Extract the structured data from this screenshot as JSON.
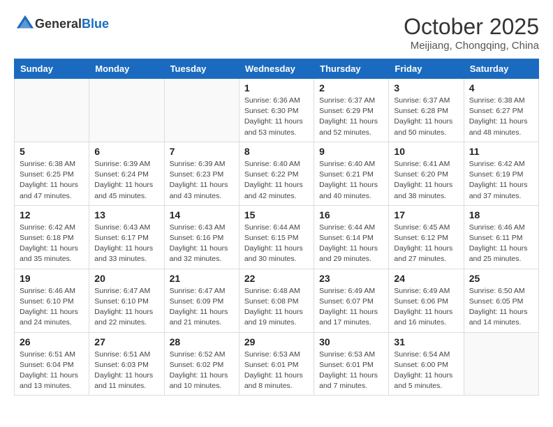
{
  "header": {
    "logo_general": "General",
    "logo_blue": "Blue",
    "month": "October 2025",
    "location": "Meijiang, Chongqing, China"
  },
  "days_of_week": [
    "Sunday",
    "Monday",
    "Tuesday",
    "Wednesday",
    "Thursday",
    "Friday",
    "Saturday"
  ],
  "weeks": [
    [
      {
        "day": "",
        "info": ""
      },
      {
        "day": "",
        "info": ""
      },
      {
        "day": "",
        "info": ""
      },
      {
        "day": "1",
        "info": "Sunrise: 6:36 AM\nSunset: 6:30 PM\nDaylight: 11 hours\nand 53 minutes."
      },
      {
        "day": "2",
        "info": "Sunrise: 6:37 AM\nSunset: 6:29 PM\nDaylight: 11 hours\nand 52 minutes."
      },
      {
        "day": "3",
        "info": "Sunrise: 6:37 AM\nSunset: 6:28 PM\nDaylight: 11 hours\nand 50 minutes."
      },
      {
        "day": "4",
        "info": "Sunrise: 6:38 AM\nSunset: 6:27 PM\nDaylight: 11 hours\nand 48 minutes."
      }
    ],
    [
      {
        "day": "5",
        "info": "Sunrise: 6:38 AM\nSunset: 6:25 PM\nDaylight: 11 hours\nand 47 minutes."
      },
      {
        "day": "6",
        "info": "Sunrise: 6:39 AM\nSunset: 6:24 PM\nDaylight: 11 hours\nand 45 minutes."
      },
      {
        "day": "7",
        "info": "Sunrise: 6:39 AM\nSunset: 6:23 PM\nDaylight: 11 hours\nand 43 minutes."
      },
      {
        "day": "8",
        "info": "Sunrise: 6:40 AM\nSunset: 6:22 PM\nDaylight: 11 hours\nand 42 minutes."
      },
      {
        "day": "9",
        "info": "Sunrise: 6:40 AM\nSunset: 6:21 PM\nDaylight: 11 hours\nand 40 minutes."
      },
      {
        "day": "10",
        "info": "Sunrise: 6:41 AM\nSunset: 6:20 PM\nDaylight: 11 hours\nand 38 minutes."
      },
      {
        "day": "11",
        "info": "Sunrise: 6:42 AM\nSunset: 6:19 PM\nDaylight: 11 hours\nand 37 minutes."
      }
    ],
    [
      {
        "day": "12",
        "info": "Sunrise: 6:42 AM\nSunset: 6:18 PM\nDaylight: 11 hours\nand 35 minutes."
      },
      {
        "day": "13",
        "info": "Sunrise: 6:43 AM\nSunset: 6:17 PM\nDaylight: 11 hours\nand 33 minutes."
      },
      {
        "day": "14",
        "info": "Sunrise: 6:43 AM\nSunset: 6:16 PM\nDaylight: 11 hours\nand 32 minutes."
      },
      {
        "day": "15",
        "info": "Sunrise: 6:44 AM\nSunset: 6:15 PM\nDaylight: 11 hours\nand 30 minutes."
      },
      {
        "day": "16",
        "info": "Sunrise: 6:44 AM\nSunset: 6:14 PM\nDaylight: 11 hours\nand 29 minutes."
      },
      {
        "day": "17",
        "info": "Sunrise: 6:45 AM\nSunset: 6:12 PM\nDaylight: 11 hours\nand 27 minutes."
      },
      {
        "day": "18",
        "info": "Sunrise: 6:46 AM\nSunset: 6:11 PM\nDaylight: 11 hours\nand 25 minutes."
      }
    ],
    [
      {
        "day": "19",
        "info": "Sunrise: 6:46 AM\nSunset: 6:10 PM\nDaylight: 11 hours\nand 24 minutes."
      },
      {
        "day": "20",
        "info": "Sunrise: 6:47 AM\nSunset: 6:10 PM\nDaylight: 11 hours\nand 22 minutes."
      },
      {
        "day": "21",
        "info": "Sunrise: 6:47 AM\nSunset: 6:09 PM\nDaylight: 11 hours\nand 21 minutes."
      },
      {
        "day": "22",
        "info": "Sunrise: 6:48 AM\nSunset: 6:08 PM\nDaylight: 11 hours\nand 19 minutes."
      },
      {
        "day": "23",
        "info": "Sunrise: 6:49 AM\nSunset: 6:07 PM\nDaylight: 11 hours\nand 17 minutes."
      },
      {
        "day": "24",
        "info": "Sunrise: 6:49 AM\nSunset: 6:06 PM\nDaylight: 11 hours\nand 16 minutes."
      },
      {
        "day": "25",
        "info": "Sunrise: 6:50 AM\nSunset: 6:05 PM\nDaylight: 11 hours\nand 14 minutes."
      }
    ],
    [
      {
        "day": "26",
        "info": "Sunrise: 6:51 AM\nSunset: 6:04 PM\nDaylight: 11 hours\nand 13 minutes."
      },
      {
        "day": "27",
        "info": "Sunrise: 6:51 AM\nSunset: 6:03 PM\nDaylight: 11 hours\nand 11 minutes."
      },
      {
        "day": "28",
        "info": "Sunrise: 6:52 AM\nSunset: 6:02 PM\nDaylight: 11 hours\nand 10 minutes."
      },
      {
        "day": "29",
        "info": "Sunrise: 6:53 AM\nSunset: 6:01 PM\nDaylight: 11 hours\nand 8 minutes."
      },
      {
        "day": "30",
        "info": "Sunrise: 6:53 AM\nSunset: 6:01 PM\nDaylight: 11 hours\nand 7 minutes."
      },
      {
        "day": "31",
        "info": "Sunrise: 6:54 AM\nSunset: 6:00 PM\nDaylight: 11 hours\nand 5 minutes."
      },
      {
        "day": "",
        "info": ""
      }
    ]
  ]
}
